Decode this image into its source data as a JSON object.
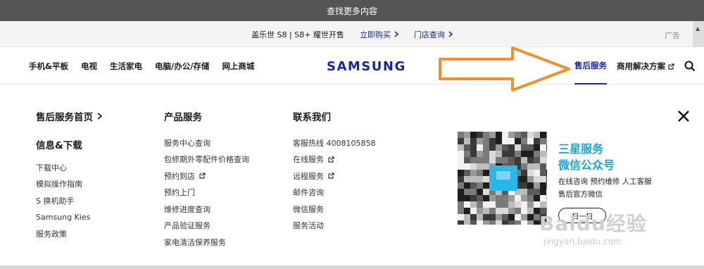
{
  "topbar": {
    "text": "查找更多内容"
  },
  "promo": {
    "title": "盖乐世 S8 | S8+ 耀世开售",
    "buy_label": "立即购买",
    "store_label": "门店查询",
    "ad_label": "广告"
  },
  "nav": {
    "left_items": [
      "手机&平板",
      "电视",
      "生活家电",
      "电脑/办公/存储",
      "网上商城"
    ],
    "logo": "SAMSUNG",
    "active_label": "售后服务",
    "business_label": "商用解决方案"
  },
  "menu": {
    "col1": {
      "heading": "售后服务首页",
      "subheading": "信息&下载",
      "items": [
        "下载中心",
        "模拟操作指南",
        "S 换机助手",
        "Samsung Kies",
        "服务政策"
      ]
    },
    "col2": {
      "heading": "产品服务",
      "items": [
        "服务中心查询",
        "包修期外零配件价格查询",
        "预约到店",
        "预约上门",
        "维修进度查询",
        "产品验证服务",
        "家电清洁保养服务"
      ]
    },
    "col3": {
      "heading": "联系我们",
      "items": [
        "客服热线 4008105858",
        "在线服务",
        "远程服务",
        "邮件咨询",
        "微信服务",
        "服务活动"
      ]
    },
    "wechat": {
      "title1": "三星服务",
      "title2": "微信公众号",
      "line1": "在线咨询  预约维修  人工客服",
      "line2": "售后官方微信",
      "button": "扫一扫"
    }
  },
  "watermark": {
    "text": "Baidu经验",
    "url": "jingyan.baidu.com"
  },
  "colors": {
    "brand": "#1428a0",
    "accent": "#1aa3d4",
    "arrow": "#f0902a"
  }
}
